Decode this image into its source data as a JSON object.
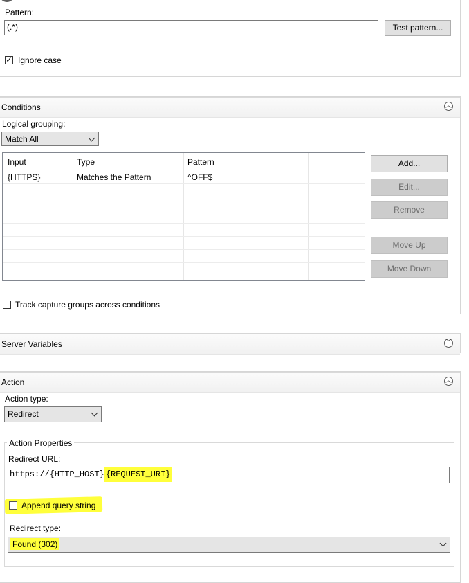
{
  "match": {
    "pattern_label": "Pattern:",
    "pattern_value": "(.*)",
    "test_pattern_button": "Test pattern...",
    "ignore_case_label": "Ignore case",
    "ignore_case_checked": true
  },
  "conditions": {
    "title": "Conditions",
    "logical_grouping_label": "Logical grouping:",
    "logical_grouping_value": "Match All",
    "columns": [
      "Input",
      "Type",
      "Pattern"
    ],
    "rows": [
      [
        "{HTTPS}",
        "Matches the Pattern",
        "^OFF$"
      ]
    ],
    "buttons": {
      "add": "Add...",
      "edit": "Edit...",
      "remove": "Remove",
      "move_up": "Move Up",
      "move_down": "Move Down"
    },
    "track_capture_label": "Track capture groups across conditions",
    "track_capture_checked": false
  },
  "server_variables": {
    "title": "Server Variables"
  },
  "action": {
    "title": "Action",
    "action_type_label": "Action type:",
    "action_type_value": "Redirect",
    "properties_label": "Action Properties",
    "redirect_url_label": "Redirect URL:",
    "redirect_url_part1": "https://",
    "redirect_url_part2": "{HTTP_HOST}",
    "redirect_url_part3": "{REQUEST_URI}",
    "append_query_label": "Append query string",
    "append_query_checked": false,
    "redirect_type_label": "Redirect type:",
    "redirect_type_value": "Found (302)"
  },
  "colors": {
    "highlight": "#ffff3b",
    "header_bg": "#f1f1f1",
    "disabled_button": "#cccccc"
  }
}
